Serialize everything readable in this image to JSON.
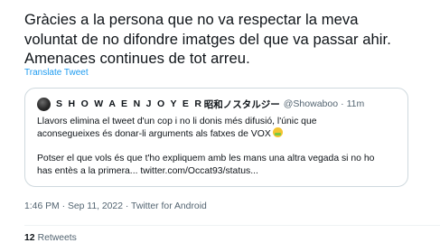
{
  "tweet": {
    "text_lines": [
      "Gràcies a la persona que no va respectar la meva",
      "voluntat de no difondre imatges del que va passar ahir.",
      "Amenaces continues de tot arreu."
    ],
    "translate_label": "Translate Tweet"
  },
  "quote": {
    "display_name": "S H O W A  E N J O Y E R",
    "display_name_jp": "昭和ノスタルジー",
    "handle": "@Showaboo",
    "separator": "·",
    "time": "11m",
    "body_lines": [
      "Llavors elimina el tweet d'un cop i no li donis més difusió, l'únic que",
      "aconsegueixes és donar-li arguments als fatxes de VOX",
      "Potser el que vols és que t'ho expliquem amb les mans una altra vegada si no ho",
      "has entès a la primera... twitter.com/Occat93/status..."
    ],
    "emoji": "nauseated-face"
  },
  "meta": {
    "time": "1:46 PM",
    "sep1": " · ",
    "date": "Sep 11, 2022",
    "sep2": " · ",
    "source": "Twitter for Android"
  },
  "stats": {
    "count": "12",
    "label": "Retweets"
  },
  "colors": {
    "text": "#0f1419",
    "muted": "#536471",
    "link": "#1d9bf0",
    "border": "#cfd9de"
  }
}
